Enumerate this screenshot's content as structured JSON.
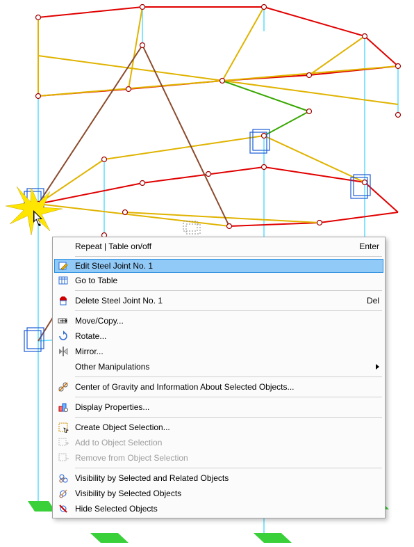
{
  "menu": {
    "items": [
      {
        "label": "Repeat | Table on/off",
        "shortcut": "Enter",
        "icon": "",
        "type": "item",
        "disabled": false
      },
      {
        "type": "sep"
      },
      {
        "label": "Edit Steel Joint No. 1",
        "icon": "edit-joint-icon",
        "type": "item",
        "highlighted": true
      },
      {
        "label": "Go to Table",
        "icon": "goto-table-icon",
        "type": "item"
      },
      {
        "type": "sep"
      },
      {
        "label": "Delete Steel Joint No. 1",
        "shortcut": "Del",
        "icon": "delete-icon",
        "type": "item"
      },
      {
        "type": "sep"
      },
      {
        "label": "Move/Copy...",
        "icon": "move-copy-icon",
        "type": "item"
      },
      {
        "label": "Rotate...",
        "icon": "rotate-icon",
        "type": "item"
      },
      {
        "label": "Mirror...",
        "icon": "mirror-icon",
        "type": "item"
      },
      {
        "label": "Other Manipulations",
        "icon": "",
        "type": "submenu"
      },
      {
        "type": "sep"
      },
      {
        "label": "Center of Gravity and Information About Selected Objects...",
        "icon": "cog-icon",
        "type": "item"
      },
      {
        "type": "sep"
      },
      {
        "label": "Display Properties...",
        "icon": "display-props-icon",
        "type": "item"
      },
      {
        "type": "sep"
      },
      {
        "label": "Create Object Selection...",
        "icon": "create-sel-icon",
        "type": "item"
      },
      {
        "label": "Add to Object Selection",
        "icon": "add-sel-icon",
        "type": "item",
        "disabled": true
      },
      {
        "label": "Remove from Object Selection",
        "icon": "remove-sel-icon",
        "type": "item",
        "disabled": true
      },
      {
        "type": "sep"
      },
      {
        "label": "Visibility by Selected and Related Objects",
        "icon": "vis-related-icon",
        "type": "item"
      },
      {
        "label": "Visibility by Selected Objects",
        "icon": "vis-sel-icon",
        "type": "item"
      },
      {
        "label": "Hide Selected Objects",
        "icon": "hide-sel-icon",
        "type": "item"
      }
    ]
  },
  "scene": {
    "description": "3D structural model wireframe with colored member lines (red, gold, green, brown, cyan), node circles, blue support boxes, green base pads, and a yellow starburst at clicked joint."
  }
}
